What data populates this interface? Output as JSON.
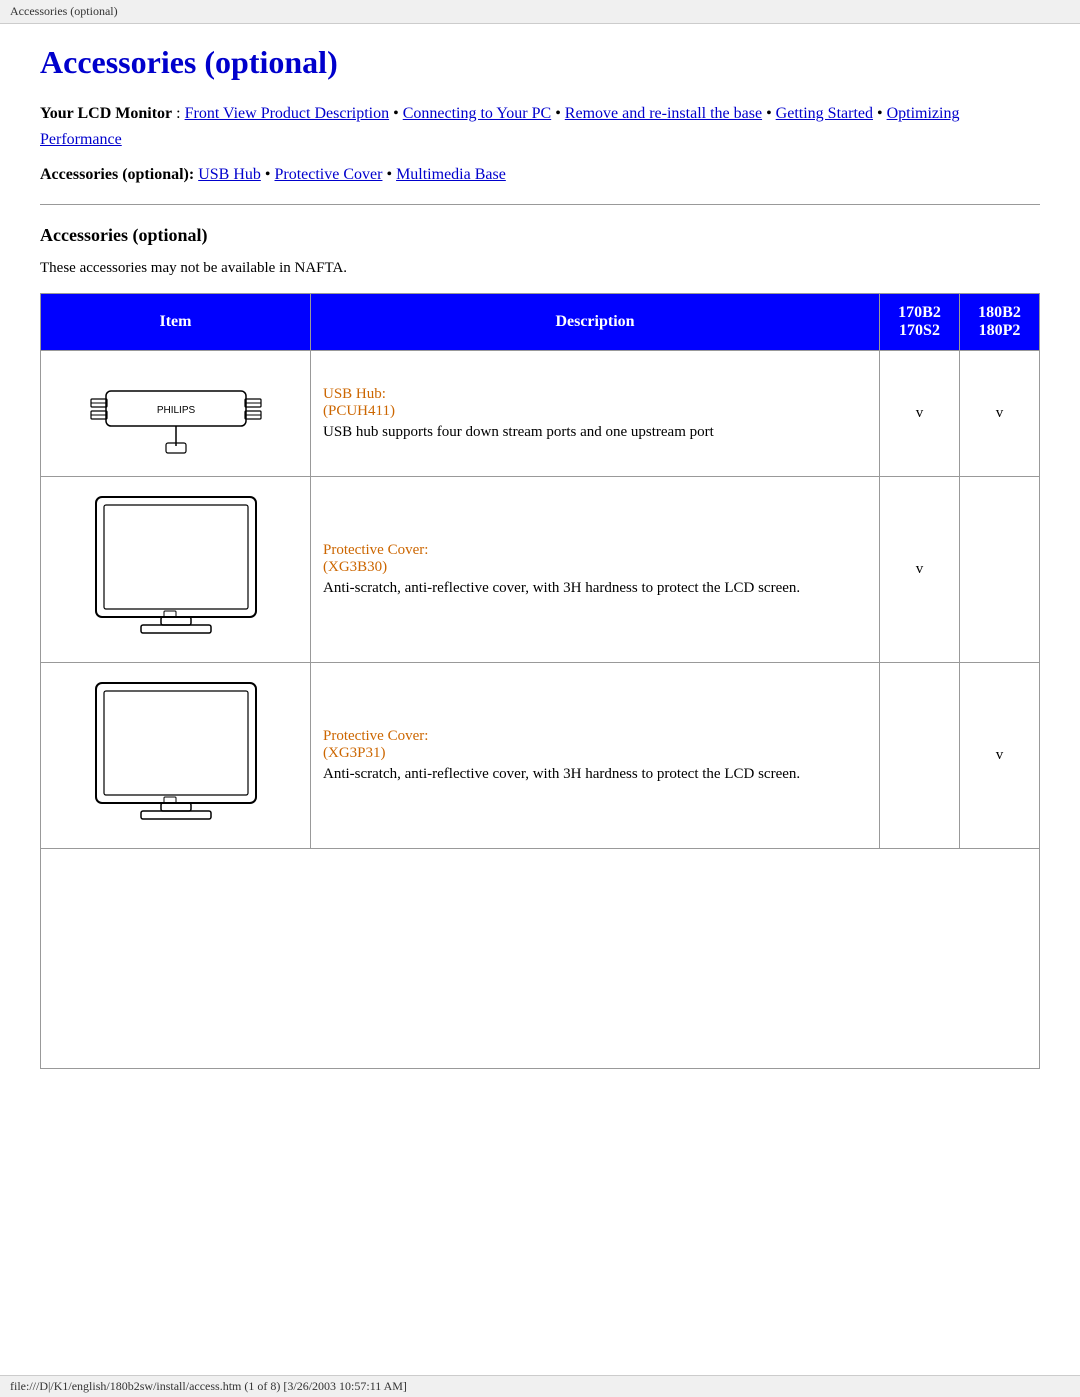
{
  "browser": {
    "title_bar": "Accessories (optional)"
  },
  "status_bar": {
    "text": "file:///D|/K1/english/180b2sw/install/access.htm (1 of 8) [3/26/2003 10:57:11 AM]"
  },
  "page": {
    "title": "Accessories (optional)",
    "breadcrumb": {
      "label": "Your LCD Monitor",
      "separator": " : ",
      "links": [
        "Front View Product Description",
        "Connecting to Your PC",
        "Remove and re-install the base",
        "Getting Started",
        "Optimizing Performance"
      ]
    },
    "accessories_links": {
      "label": "Accessories (optional):",
      "links": [
        "USB Hub",
        "Protective Cover",
        "Multimedia Base"
      ]
    },
    "section_heading": "Accessories (optional)",
    "intro": "These accessories may not be available in NAFTA.",
    "table": {
      "headers": [
        "Item",
        "Description",
        "170B2\n170S2",
        "180B2\n180P2"
      ],
      "rows": [
        {
          "desc_title": "USB Hub:",
          "desc_subtitle": "(PCUH411)",
          "desc_body": "USB hub supports four down stream ports and one upstream port",
          "col1": "v",
          "col2": "v"
        },
        {
          "desc_title": "Protective Cover:",
          "desc_subtitle": "(XG3B30)",
          "desc_body": "Anti-scratch, anti-reflective cover, with 3H hardness to protect the LCD screen.",
          "col1": "v",
          "col2": ""
        },
        {
          "desc_title": "Protective Cover:",
          "desc_subtitle": "(XG3P31)",
          "desc_body": "Anti-scratch, anti-reflective cover, with 3H hardness to protect the LCD screen.",
          "col1": "",
          "col2": "v"
        }
      ]
    }
  }
}
